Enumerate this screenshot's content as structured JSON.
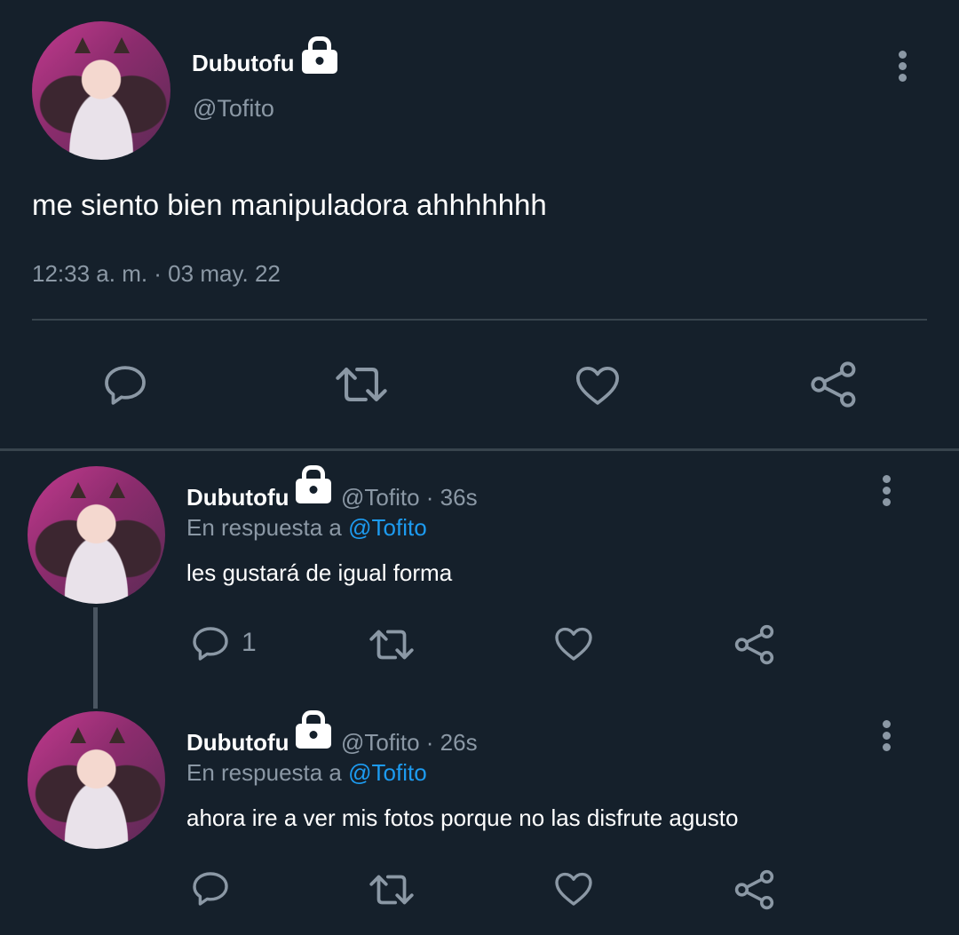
{
  "main_tweet": {
    "display_name": "Dubutofu",
    "handle": "@Tofito",
    "text": "me siento bien manipuladora ahhhhhhh",
    "timestamp": "12:33 a. m. · 03 may. 22",
    "actions": [
      "reply-icon",
      "retweet-icon",
      "like-icon",
      "share-icon"
    ]
  },
  "replies": [
    {
      "display_name": "Dubutofu",
      "handle_time": "@Tofito · 36s",
      "replying_prefix": "En respuesta a",
      "replying_to": "@Tofito",
      "text": "les gustará de igual forma",
      "reply_count": "1"
    },
    {
      "display_name": "Dubutofu",
      "handle_time": "@Tofito · 26s",
      "replying_prefix": "En respuesta a",
      "replying_to": "@Tofito",
      "text": "ahora ire a ver mis fotos porque no las disfrute agusto",
      "reply_count": ""
    }
  ],
  "colors": {
    "background": "#15202b",
    "text": "#ffffff",
    "muted": "#8b98a5",
    "link": "#1d9bf0",
    "divider": "#38444d"
  }
}
